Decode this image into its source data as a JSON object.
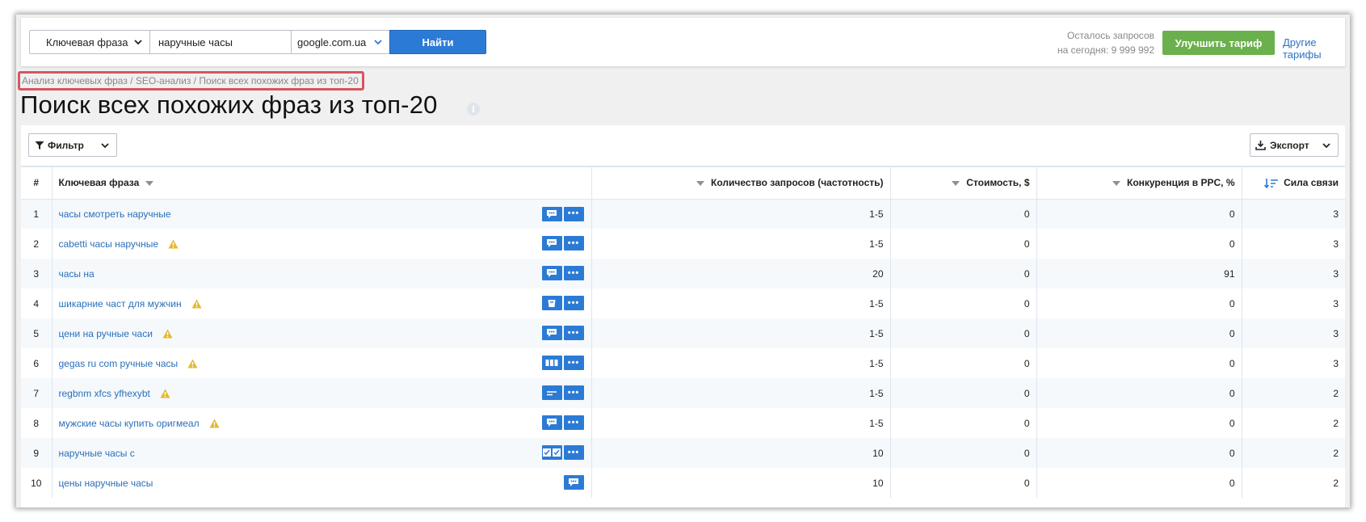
{
  "search": {
    "type_label": "Ключевая фраза",
    "query_value": "наручные часы",
    "database": "google.com.ua",
    "find_label": "Найти"
  },
  "quota": {
    "line1": "Осталось запросов",
    "line2": "на сегодня: 9 999 992"
  },
  "header": {
    "upgrade_label": "Улучшить тариф",
    "other_plans_label": "Другие тарифы"
  },
  "breadcrumb": "Анализ ключевых фраз / SEO-анализ / Поиск всех похожих фраз из топ-20",
  "page_title": "Поиск всех похожих фраз из топ-20",
  "toolbar": {
    "filter_label": "Фильтр",
    "export_label": "Экспорт"
  },
  "table": {
    "columns": {
      "index": "#",
      "keyword": "Ключевая фраза",
      "volume": "Количество запросов (частотность)",
      "cost": "Стоимость, $",
      "competition": "Конкуренция в PPC, %",
      "relevance": "Сила связи"
    },
    "rows": [
      {
        "n": "1",
        "keyword": "часы смотреть наручные",
        "warn": false,
        "icon": "snippet",
        "more": true,
        "volume": "1-5",
        "cost": "0",
        "competition": "0",
        "relevance": "3"
      },
      {
        "n": "2",
        "keyword": "cabetti часы наручные",
        "warn": true,
        "icon": "snippet",
        "more": true,
        "volume": "1-5",
        "cost": "0",
        "competition": "0",
        "relevance": "3"
      },
      {
        "n": "3",
        "keyword": "часы на",
        "warn": false,
        "icon": "snippet",
        "more": true,
        "volume": "20",
        "cost": "0",
        "competition": "91",
        "relevance": "3"
      },
      {
        "n": "4",
        "keyword": "шикарние част для мужчин",
        "warn": true,
        "icon": "shopping",
        "more": true,
        "volume": "1-5",
        "cost": "0",
        "competition": "0",
        "relevance": "3"
      },
      {
        "n": "5",
        "keyword": "цени на ручные часи",
        "warn": true,
        "icon": "snippet",
        "more": true,
        "volume": "1-5",
        "cost": "0",
        "competition": "0",
        "relevance": "3"
      },
      {
        "n": "6",
        "keyword": "gegas ru com ручные часы",
        "warn": true,
        "icon": "columns",
        "more": true,
        "volume": "1-5",
        "cost": "0",
        "competition": "0",
        "relevance": "3"
      },
      {
        "n": "7",
        "keyword": "regbnm xfcs yfhexybt",
        "warn": true,
        "icon": "lines",
        "more": true,
        "volume": "1-5",
        "cost": "0",
        "competition": "0",
        "relevance": "2"
      },
      {
        "n": "8",
        "keyword": "мужские часы купить оригмеал",
        "warn": true,
        "icon": "snippet",
        "more": true,
        "volume": "1-5",
        "cost": "0",
        "competition": "0",
        "relevance": "2"
      },
      {
        "n": "9",
        "keyword": "наручные часы с",
        "warn": false,
        "icon": "checklist",
        "more": true,
        "volume": "10",
        "cost": "0",
        "competition": "0",
        "relevance": "2"
      },
      {
        "n": "10",
        "keyword": "цены наручные часы",
        "warn": false,
        "icon": "snippet",
        "more": false,
        "volume": "10",
        "cost": "0",
        "competition": "0",
        "relevance": "2"
      }
    ]
  },
  "colors": {
    "accent": "#2b7bd6",
    "upgrade": "#6ab04c",
    "link": "#2a6fba",
    "warning": "#e3b92f",
    "breadcrumb_highlight": "#d4575f"
  }
}
